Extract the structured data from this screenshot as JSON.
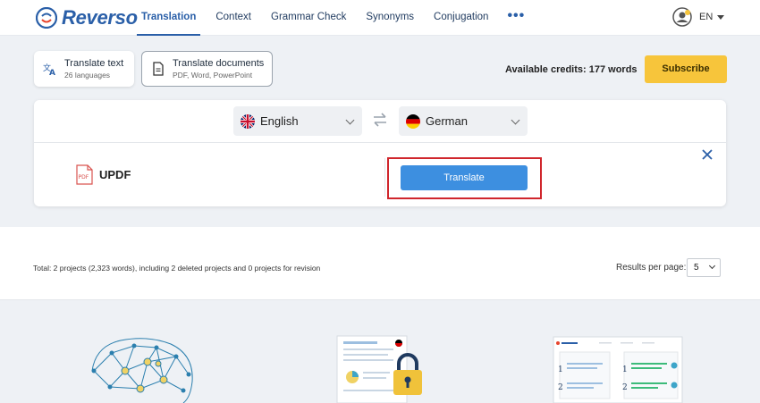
{
  "header": {
    "logo_text": "Reverso",
    "nav": [
      {
        "label": "Translation",
        "active": true
      },
      {
        "label": "Context",
        "active": false
      },
      {
        "label": "Grammar Check",
        "active": false
      },
      {
        "label": "Synonyms",
        "active": false
      },
      {
        "label": "Conjugation",
        "active": false
      }
    ],
    "more_label": "•••",
    "ui_language": "EN"
  },
  "modes": {
    "text": {
      "title": "Translate text",
      "subtitle": "26 languages",
      "icon": "translate-icon"
    },
    "documents": {
      "title": "Translate documents",
      "subtitle": "PDF, Word, PowerPoint",
      "icon": "document-icon"
    }
  },
  "credits_text": "Available credits: 177 words",
  "subscribe_label": "Subscribe",
  "translator": {
    "source_language": "English",
    "target_language": "German",
    "file_name": "UPDF",
    "translate_label": "Translate"
  },
  "summary": {
    "text": "Total: 2 projects (2,323 words), including 2 deleted projects and 0 projects for revision",
    "results_per_page_label": "Results per page:",
    "results_per_page_value": "5"
  },
  "colors": {
    "brand": "#2a5fa8",
    "accent_button": "#3d8fe0",
    "subscribe": "#f7c53b",
    "highlight": "#d0262c"
  }
}
